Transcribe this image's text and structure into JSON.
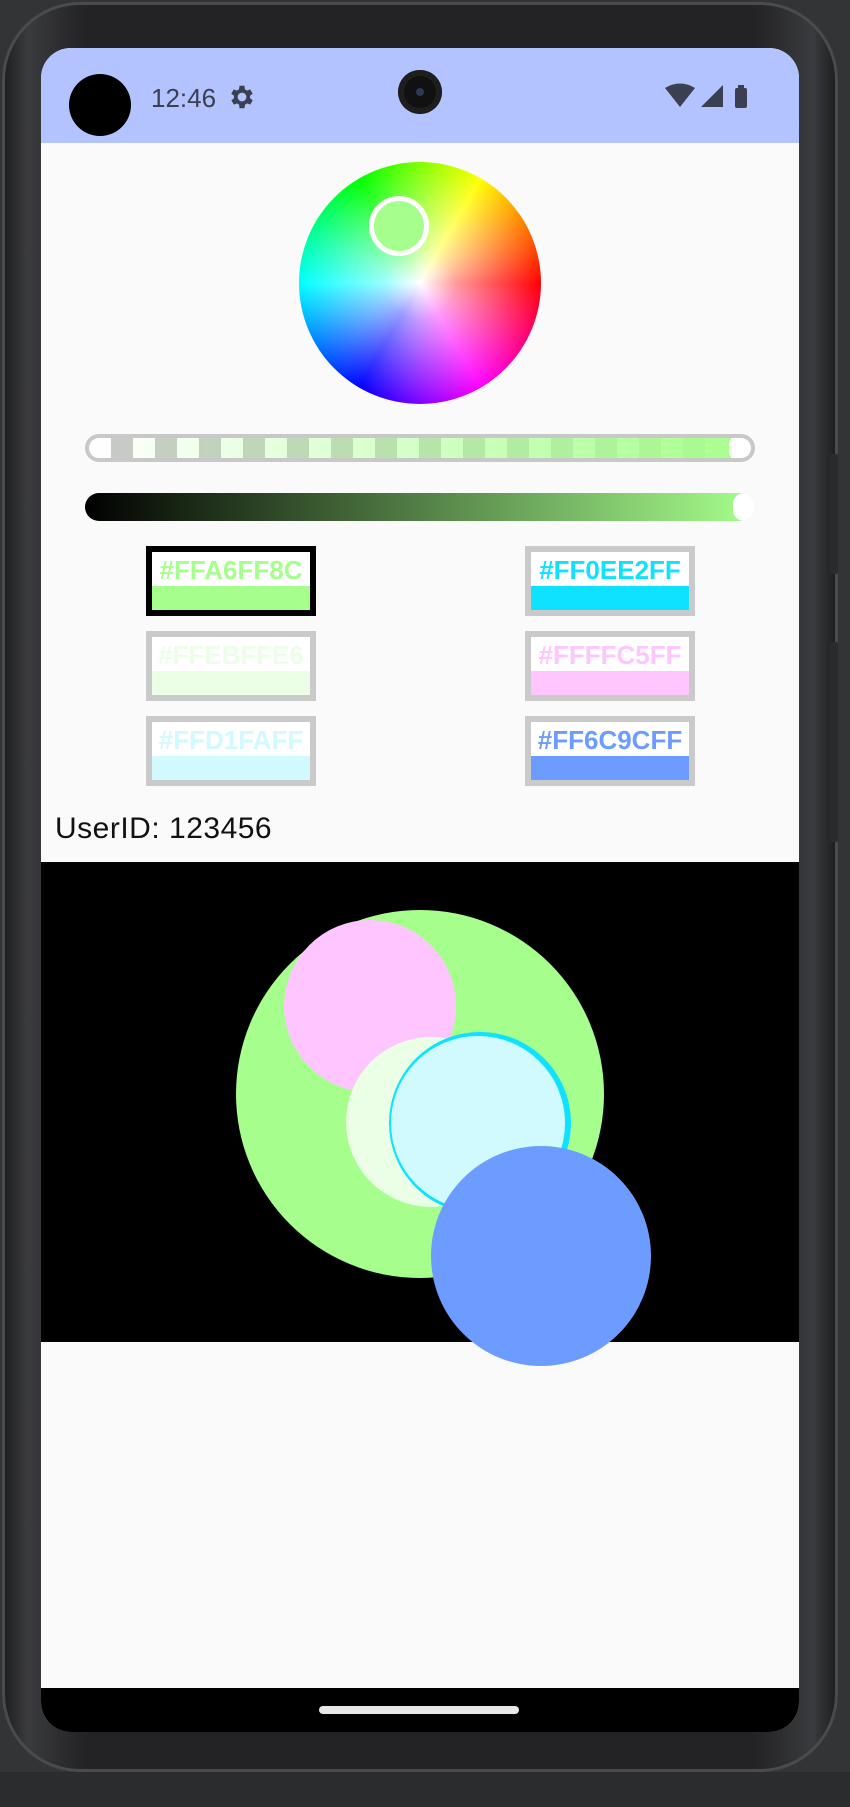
{
  "status_bar": {
    "time": "12:46",
    "icons": [
      "gear-icon",
      "wifi-icon",
      "signal-icon",
      "battery-icon"
    ],
    "background": "#b3c3ff"
  },
  "color_picker": {
    "selected_color": "#a6ff8c",
    "alpha_level": 1.0,
    "value_level": 1.0
  },
  "swatches": [
    {
      "hex": "#FFA6FF8C",
      "color": "#a6ff8c",
      "selected": true
    },
    {
      "hex": "#FF0EE2FF",
      "color": "#0ee2ff",
      "selected": false
    },
    {
      "hex": "#FFEBFFE6",
      "color": "#ebffe6",
      "selected": false
    },
    {
      "hex": "#FFFFC5FF",
      "color": "#ffc5ff",
      "selected": false
    },
    {
      "hex": "#FFD1FAFF",
      "color": "#d1faff",
      "selected": false
    },
    {
      "hex": "#FF6C9CFF",
      "color": "#6c9cff",
      "selected": false
    }
  ],
  "user": {
    "label": "UserID: 123456"
  },
  "canvas": {
    "background": "#000000",
    "shape_colors": [
      "#a6ff8c",
      "#ffc5ff",
      "#ebffe6",
      "#0ee2ff",
      "#d1faff",
      "#6c9cff"
    ]
  }
}
